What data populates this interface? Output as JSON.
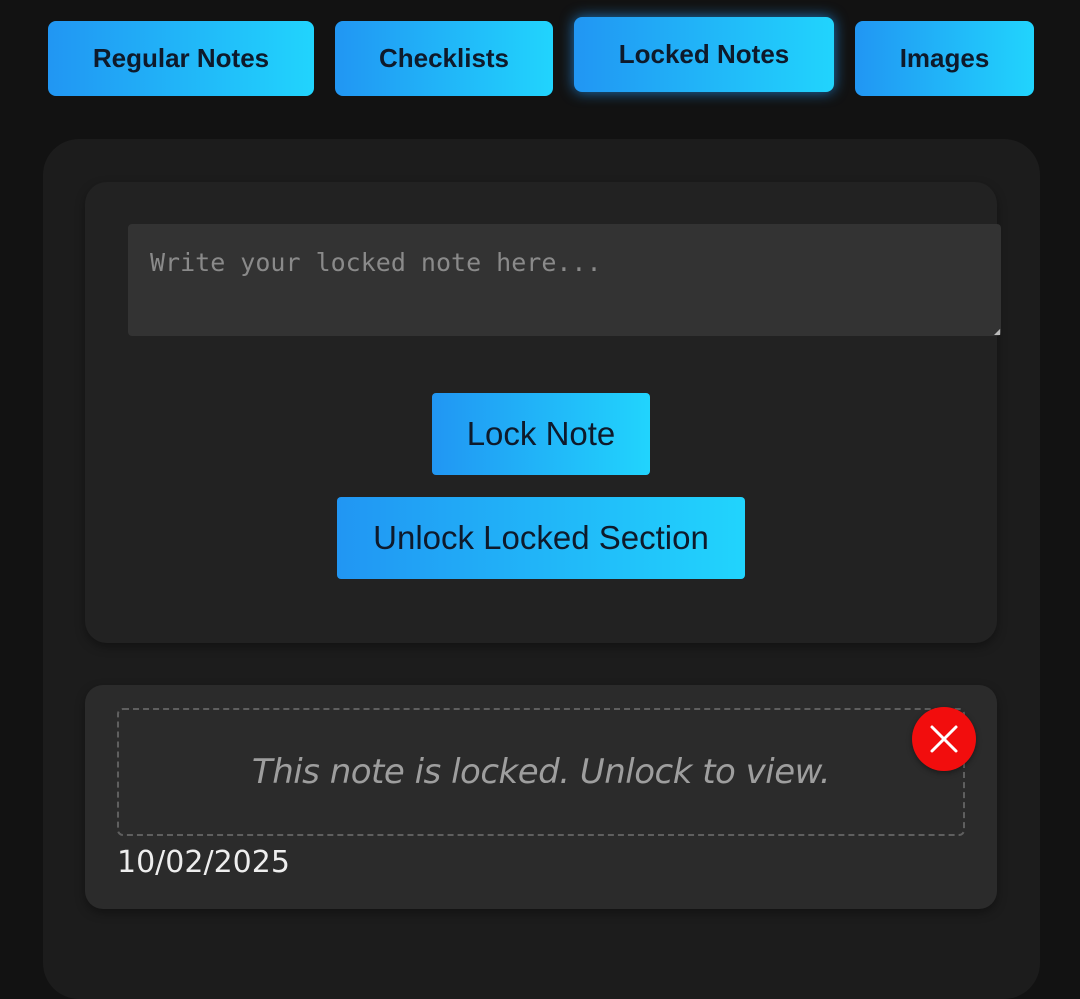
{
  "tabs": [
    {
      "label": "Regular Notes",
      "active": false
    },
    {
      "label": "Checklists",
      "active": false
    },
    {
      "label": "Locked Notes",
      "active": true
    },
    {
      "label": "Images",
      "active": false
    }
  ],
  "compose": {
    "placeholder": "Write your locked note here...",
    "value": "",
    "lock_button_label": "Lock Note",
    "unlock_button_label": "Unlock Locked Section"
  },
  "locked_note": {
    "message": "This note is locked. Unlock to view.",
    "date": "10/02/2025",
    "delete_icon": "close-icon"
  },
  "colors": {
    "accent_start": "#2196f3",
    "accent_end": "#21d4fd",
    "delete": "#f20d0d",
    "background": "#121212"
  }
}
